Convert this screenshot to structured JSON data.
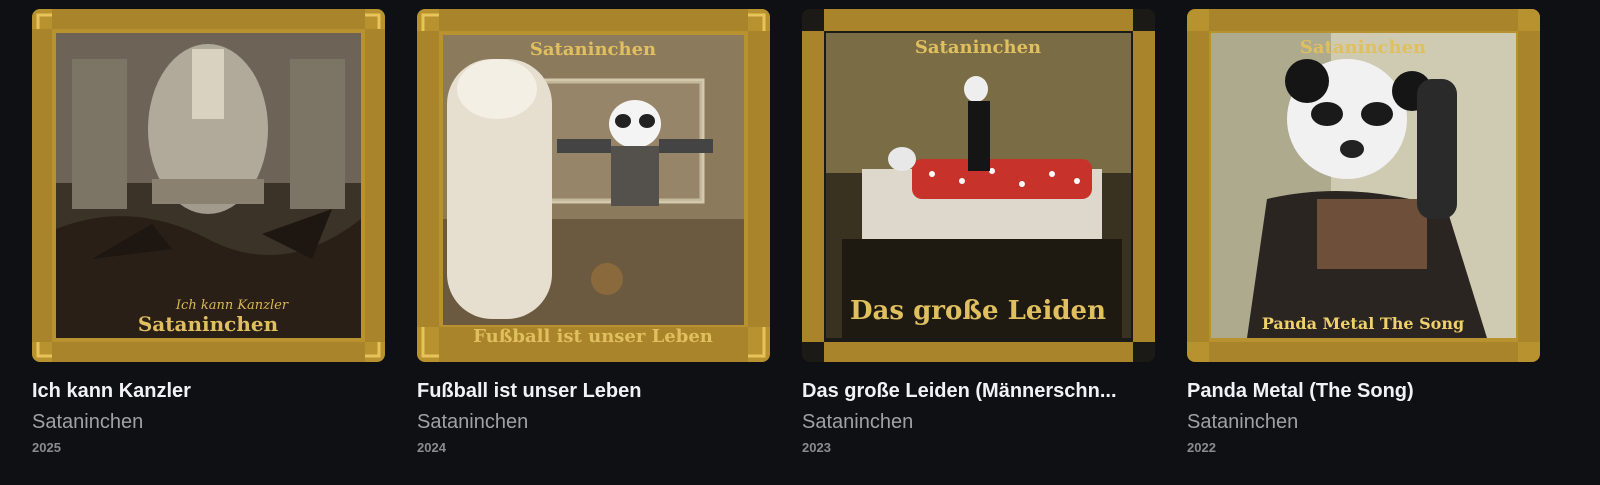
{
  "albums": [
    {
      "title": "Ich kann Kanzler",
      "artist": "Sataninchen",
      "year": "2025",
      "cover_text_top": "Ich kann Kanzler",
      "cover_text_bottom": "Sataninchen",
      "accent": "#c9a440"
    },
    {
      "title": "Fußball ist unser Leben",
      "artist": "Sataninchen",
      "year": "2024",
      "cover_text_top": "Sataninchen",
      "cover_text_bottom": "Fußball ist unser Leben",
      "accent": "#c9a440"
    },
    {
      "title": "Das große Leiden (Männerschn...",
      "artist": "Sataninchen",
      "year": "2023",
      "cover_text_top": "Sataninchen",
      "cover_text_bottom": "Das große Leiden",
      "accent": "#c9a440"
    },
    {
      "title": "Panda Metal (The Song)",
      "artist": "Sataninchen",
      "year": "2022",
      "cover_text_top": "Sataninchen",
      "cover_text_bottom": "Panda Metal The Song",
      "accent": "#c9a440"
    }
  ]
}
